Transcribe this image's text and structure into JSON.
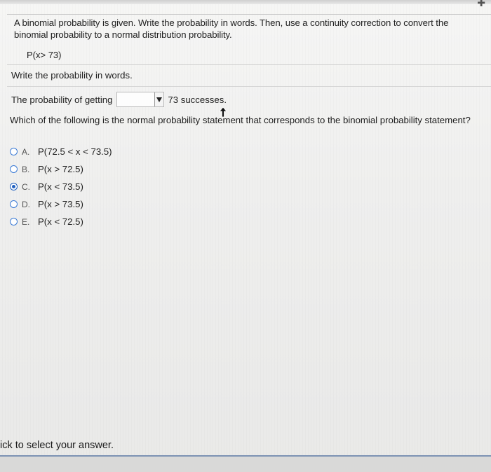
{
  "question": {
    "prompt": "A binomial probability is given. Write the probability in words. Then, use a continuity correction to convert the binomial probability to a normal distribution probability.",
    "expression": "P(x> 73)"
  },
  "words": {
    "prompt": "Write the probability in words.",
    "lead": "The probability of getting",
    "dropdown_value": "",
    "suffix": "73 successes."
  },
  "normal": {
    "question": "Which of the following is the normal probability statement that corresponds to the binomial probability statement?",
    "options": [
      {
        "letter": "A.",
        "text": "P(72.5 < x < 73.5)"
      },
      {
        "letter": "B.",
        "text": "P(x > 72.5)"
      },
      {
        "letter": "C.",
        "text": "P(x < 73.5)"
      },
      {
        "letter": "D.",
        "text": "P(x > 73.5)"
      },
      {
        "letter": "E.",
        "text": "P(x < 72.5)"
      }
    ],
    "selected": "C."
  },
  "footer": {
    "text": "ick to select your answer."
  },
  "colors": {
    "radio_accent": "#1f5fbf",
    "footer_rule": "#7d93b4"
  },
  "icons": {
    "dropdown": "caret-down-icon",
    "pointer": "cursor-arrow-icon",
    "corner": "close-icon"
  }
}
